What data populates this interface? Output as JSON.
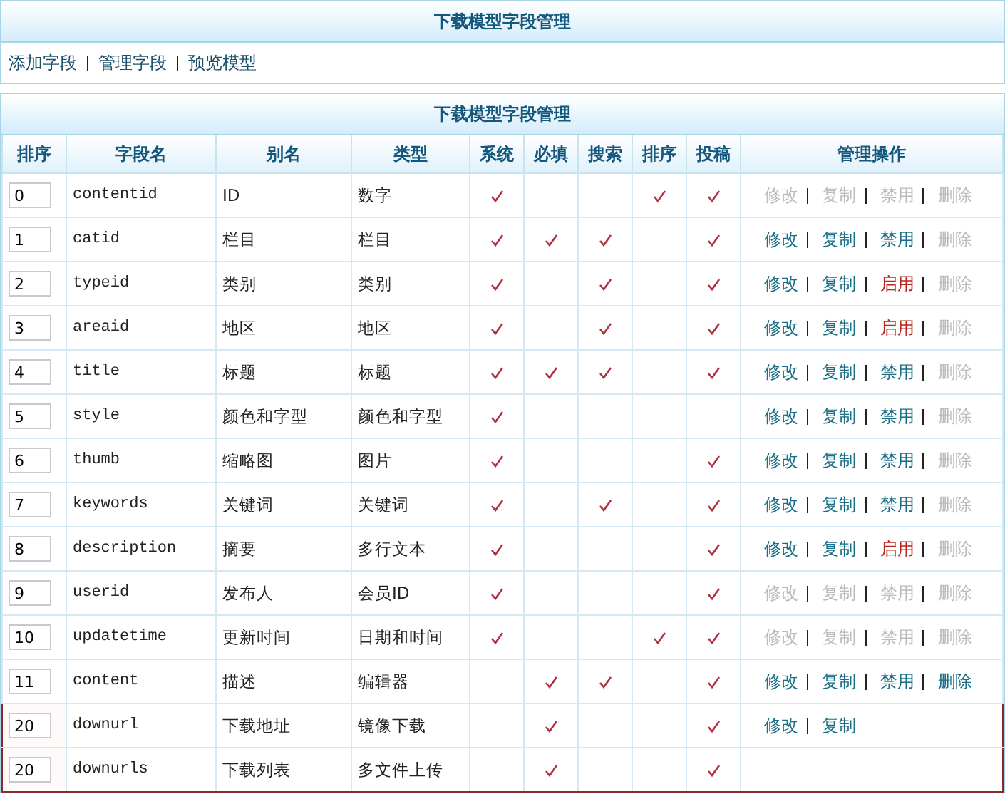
{
  "top_panel": {
    "title": "下载模型字段管理",
    "links": [
      "添加字段",
      "管理字段",
      "预览模型"
    ]
  },
  "table_panel": {
    "title": "下载模型字段管理",
    "columns": [
      "排序",
      "字段名",
      "别名",
      "类型",
      "系统",
      "必填",
      "搜索",
      "排序",
      "投稿",
      "管理操作"
    ],
    "rows": [
      {
        "order": "0",
        "field": "contentid",
        "alias": "ID",
        "type": "数字",
        "checks": [
          true,
          false,
          false,
          true,
          true
        ],
        "highlighted": false,
        "actions": [
          {
            "label": "修改",
            "disabled": true,
            "warning": false
          },
          {
            "label": "复制",
            "disabled": true,
            "warning": false
          },
          {
            "label": "禁用",
            "disabled": true,
            "warning": false
          },
          {
            "label": "删除",
            "disabled": true,
            "warning": false
          }
        ]
      },
      {
        "order": "1",
        "field": "catid",
        "alias": "栏目",
        "type": "栏目",
        "checks": [
          true,
          true,
          true,
          false,
          true
        ],
        "highlighted": false,
        "actions": [
          {
            "label": "修改",
            "disabled": false,
            "warning": false
          },
          {
            "label": "复制",
            "disabled": false,
            "warning": false
          },
          {
            "label": "禁用",
            "disabled": false,
            "warning": false
          },
          {
            "label": "删除",
            "disabled": true,
            "warning": false
          }
        ]
      },
      {
        "order": "2",
        "field": "typeid",
        "alias": "类别",
        "type": "类别",
        "checks": [
          true,
          false,
          true,
          false,
          true
        ],
        "highlighted": false,
        "actions": [
          {
            "label": "修改",
            "disabled": false,
            "warning": false
          },
          {
            "label": "复制",
            "disabled": false,
            "warning": false
          },
          {
            "label": "启用",
            "disabled": false,
            "warning": true
          },
          {
            "label": "删除",
            "disabled": true,
            "warning": false
          }
        ]
      },
      {
        "order": "3",
        "field": "areaid",
        "alias": "地区",
        "type": "地区",
        "checks": [
          true,
          false,
          true,
          false,
          true
        ],
        "highlighted": false,
        "actions": [
          {
            "label": "修改",
            "disabled": false,
            "warning": false
          },
          {
            "label": "复制",
            "disabled": false,
            "warning": false
          },
          {
            "label": "启用",
            "disabled": false,
            "warning": true
          },
          {
            "label": "删除",
            "disabled": true,
            "warning": false
          }
        ]
      },
      {
        "order": "4",
        "field": "title",
        "alias": "标题",
        "type": "标题",
        "checks": [
          true,
          true,
          true,
          false,
          true
        ],
        "highlighted": false,
        "actions": [
          {
            "label": "修改",
            "disabled": false,
            "warning": false
          },
          {
            "label": "复制",
            "disabled": false,
            "warning": false
          },
          {
            "label": "禁用",
            "disabled": false,
            "warning": false
          },
          {
            "label": "删除",
            "disabled": true,
            "warning": false
          }
        ]
      },
      {
        "order": "5",
        "field": "style",
        "alias": "颜色和字型",
        "type": "颜色和字型",
        "checks": [
          true,
          false,
          false,
          false,
          false
        ],
        "highlighted": false,
        "actions": [
          {
            "label": "修改",
            "disabled": false,
            "warning": false
          },
          {
            "label": "复制",
            "disabled": false,
            "warning": false
          },
          {
            "label": "禁用",
            "disabled": false,
            "warning": false
          },
          {
            "label": "删除",
            "disabled": true,
            "warning": false
          }
        ]
      },
      {
        "order": "6",
        "field": "thumb",
        "alias": "缩略图",
        "type": "图片",
        "checks": [
          true,
          false,
          false,
          false,
          true
        ],
        "highlighted": false,
        "actions": [
          {
            "label": "修改",
            "disabled": false,
            "warning": false
          },
          {
            "label": "复制",
            "disabled": false,
            "warning": false
          },
          {
            "label": "禁用",
            "disabled": false,
            "warning": false
          },
          {
            "label": "删除",
            "disabled": true,
            "warning": false
          }
        ]
      },
      {
        "order": "7",
        "field": "keywords",
        "alias": "关键词",
        "type": "关键词",
        "checks": [
          true,
          false,
          true,
          false,
          true
        ],
        "highlighted": false,
        "actions": [
          {
            "label": "修改",
            "disabled": false,
            "warning": false
          },
          {
            "label": "复制",
            "disabled": false,
            "warning": false
          },
          {
            "label": "禁用",
            "disabled": false,
            "warning": false
          },
          {
            "label": "删除",
            "disabled": true,
            "warning": false
          }
        ]
      },
      {
        "order": "8",
        "field": "description",
        "alias": "摘要",
        "type": "多行文本",
        "checks": [
          true,
          false,
          false,
          false,
          true
        ],
        "highlighted": false,
        "actions": [
          {
            "label": "修改",
            "disabled": false,
            "warning": false
          },
          {
            "label": "复制",
            "disabled": false,
            "warning": false
          },
          {
            "label": "启用",
            "disabled": false,
            "warning": true
          },
          {
            "label": "删除",
            "disabled": true,
            "warning": false
          }
        ]
      },
      {
        "order": "9",
        "field": "userid",
        "alias": "发布人",
        "type": "会员ID",
        "checks": [
          true,
          false,
          false,
          false,
          true
        ],
        "highlighted": false,
        "actions": [
          {
            "label": "修改",
            "disabled": true,
            "warning": false
          },
          {
            "label": "复制",
            "disabled": true,
            "warning": false
          },
          {
            "label": "禁用",
            "disabled": true,
            "warning": false
          },
          {
            "label": "删除",
            "disabled": true,
            "warning": false
          }
        ]
      },
      {
        "order": "10",
        "field": "updatetime",
        "alias": "更新时间",
        "type": "日期和时间",
        "checks": [
          true,
          false,
          false,
          true,
          true
        ],
        "highlighted": false,
        "actions": [
          {
            "label": "修改",
            "disabled": true,
            "warning": false
          },
          {
            "label": "复制",
            "disabled": true,
            "warning": false
          },
          {
            "label": "禁用",
            "disabled": true,
            "warning": false
          },
          {
            "label": "删除",
            "disabled": true,
            "warning": false
          }
        ]
      },
      {
        "order": "11",
        "field": "content",
        "alias": "描述",
        "type": "编辑器",
        "checks": [
          false,
          true,
          true,
          false,
          true
        ],
        "highlighted": false,
        "actions": [
          {
            "label": "修改",
            "disabled": false,
            "warning": false
          },
          {
            "label": "复制",
            "disabled": false,
            "warning": false
          },
          {
            "label": "禁用",
            "disabled": false,
            "warning": false
          },
          {
            "label": "删除",
            "disabled": false,
            "warning": false
          }
        ]
      },
      {
        "order": "20",
        "field": "downurl",
        "alias": "下载地址",
        "type": "镜像下载",
        "checks": [
          false,
          true,
          false,
          false,
          true
        ],
        "highlighted": true,
        "actions": [
          {
            "label": "修改",
            "disabled": false,
            "warning": false
          },
          {
            "label": "复制",
            "disabled": false,
            "warning": false
          }
        ]
      },
      {
        "order": "20",
        "field": "downurls",
        "alias": "下载列表",
        "type": "多文件上传",
        "checks": [
          false,
          true,
          false,
          false,
          true
        ],
        "highlighted": true,
        "actions": []
      }
    ]
  }
}
